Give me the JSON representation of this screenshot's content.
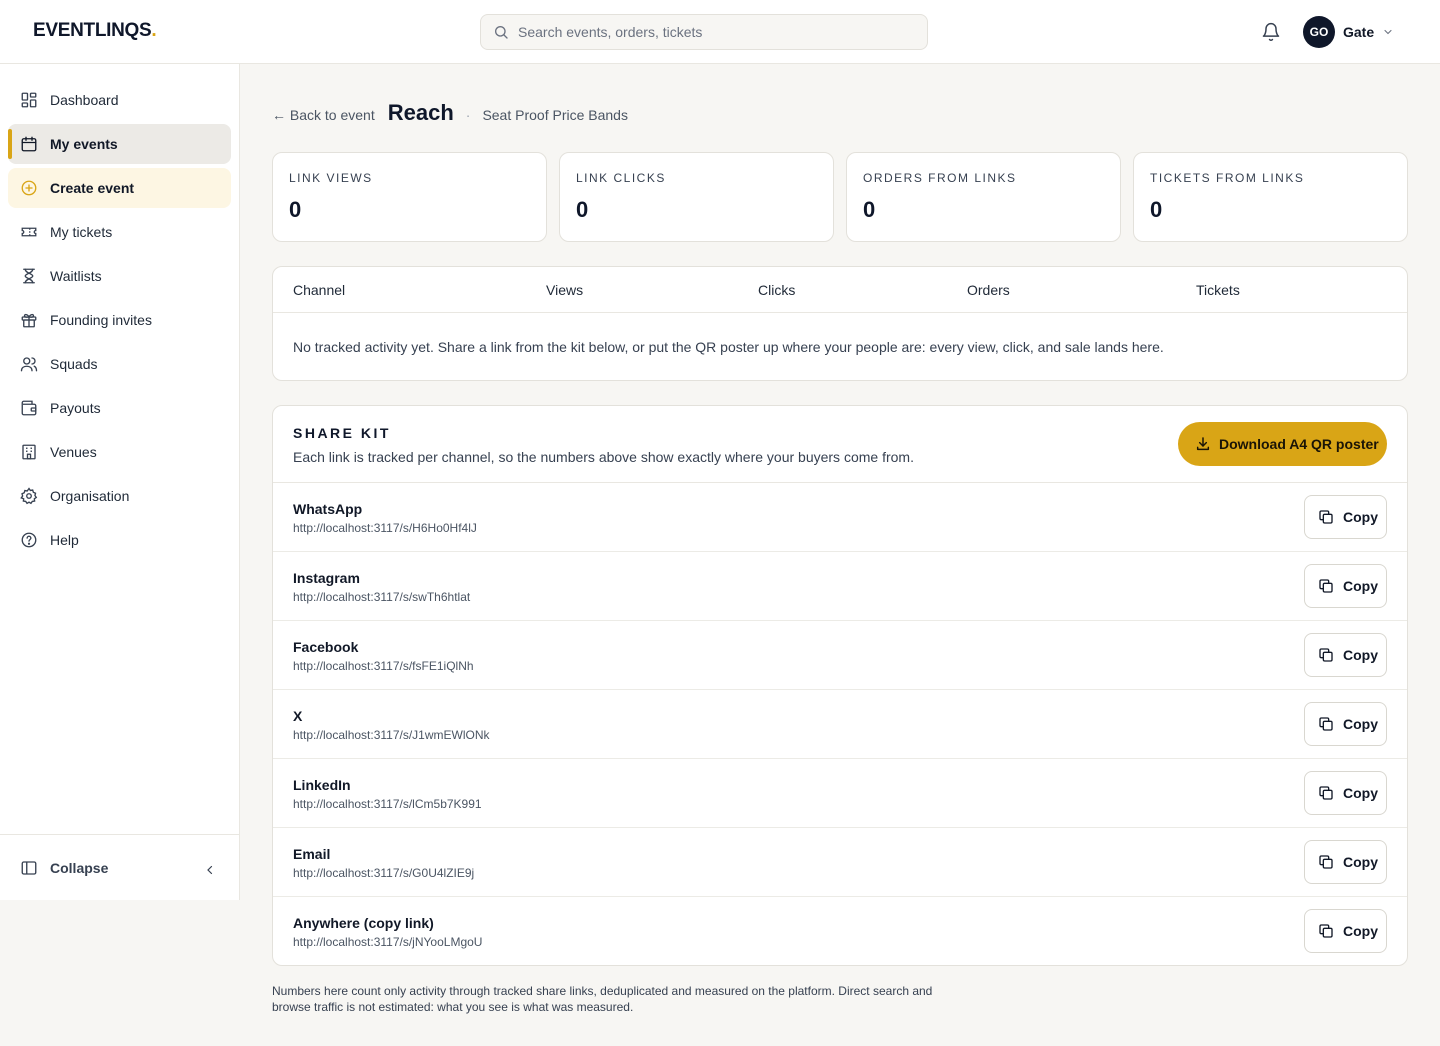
{
  "header": {
    "logo_text": "EVENTLINQS",
    "logo_dot": ".",
    "search_placeholder": "Search events, orders, tickets",
    "user": {
      "initials": "GO",
      "name": "Gate"
    }
  },
  "sidebar": {
    "items": [
      {
        "label": "Dashboard",
        "icon": "dashboard-icon"
      },
      {
        "label": "My events",
        "icon": "calendar-icon",
        "active": true
      },
      {
        "label": "Create event",
        "icon": "plus-circle-icon"
      },
      {
        "label": "My tickets",
        "icon": "ticket-icon"
      },
      {
        "label": "Waitlists",
        "icon": "hourglass-icon"
      },
      {
        "label": "Founding invites",
        "icon": "gift-icon"
      },
      {
        "label": "Squads",
        "icon": "users-icon"
      },
      {
        "label": "Payouts",
        "icon": "wallet-icon"
      },
      {
        "label": "Venues",
        "icon": "building-icon"
      },
      {
        "label": "Organisation",
        "icon": "gear-icon"
      },
      {
        "label": "Help",
        "icon": "help-icon"
      }
    ],
    "collapse_label": "Collapse"
  },
  "page": {
    "back_label": "← Back to event",
    "title": "Reach",
    "separator": "·",
    "subtitle": "Seat Proof Price Bands"
  },
  "stats": [
    {
      "label": "LINK VIEWS",
      "value": "0"
    },
    {
      "label": "LINK CLICKS",
      "value": "0"
    },
    {
      "label": "ORDERS FROM LINKS",
      "value": "0"
    },
    {
      "label": "TICKETS FROM LINKS",
      "value": "0"
    }
  ],
  "channels_table": {
    "columns": [
      "Channel",
      "Views",
      "Clicks",
      "Orders",
      "Tickets"
    ],
    "empty_message": "No tracked activity yet. Share a link from the kit below, or put the QR poster up where your people are: every view, click, and sale lands here."
  },
  "share_kit": {
    "title": "SHARE KIT",
    "description": "Each link is tracked per channel, so the numbers above show exactly where your buyers come from.",
    "download_label": "Download A4 QR poster",
    "copy_label": "Copy",
    "links": [
      {
        "channel": "WhatsApp",
        "url": "http://localhost:3117/s/H6Ho0Hf4lJ"
      },
      {
        "channel": "Instagram",
        "url": "http://localhost:3117/s/swTh6htlat"
      },
      {
        "channel": "Facebook",
        "url": "http://localhost:3117/s/fsFE1iQlNh"
      },
      {
        "channel": "X",
        "url": "http://localhost:3117/s/J1wmEWlONk"
      },
      {
        "channel": "LinkedIn",
        "url": "http://localhost:3117/s/lCm5b7K991"
      },
      {
        "channel": "Email",
        "url": "http://localhost:3117/s/G0U4lZIE9j"
      },
      {
        "channel": "Anywhere (copy link)",
        "url": "http://localhost:3117/s/jNYooLMgoU"
      }
    ]
  },
  "footnote": "Numbers here count only activity through tracked share links, deduplicated and measured on the platform. Direct search and browse traffic is not estimated: what you see is what was measured.",
  "colors": {
    "accent": "#d9a516",
    "ink": "#0f172a",
    "page_bg": "#f7f6f3"
  }
}
